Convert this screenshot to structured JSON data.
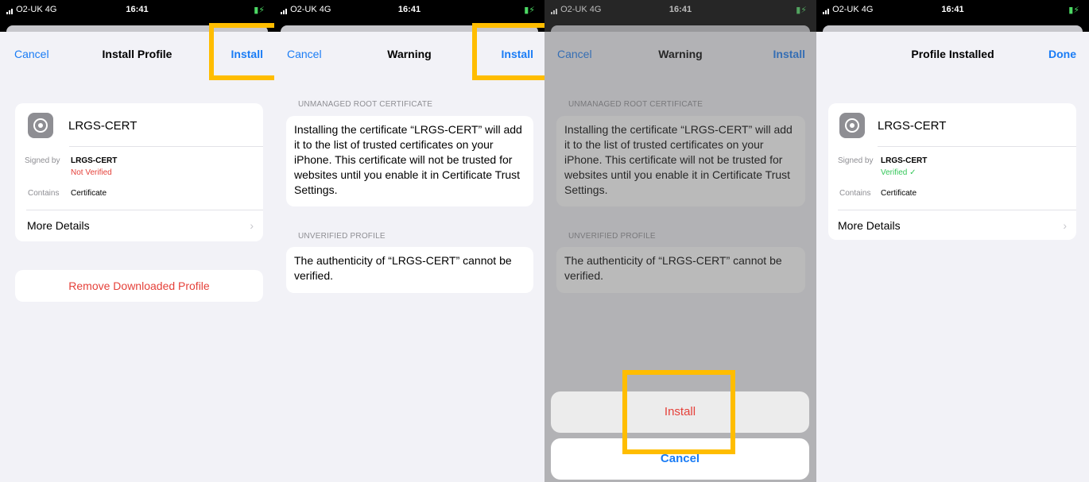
{
  "status": {
    "carrier": "O2-UK",
    "network": "4G",
    "time": "16:41"
  },
  "screen1": {
    "nav": {
      "left": "Cancel",
      "title": "Install Profile",
      "right": "Install"
    },
    "profile": {
      "name": "LRGS-CERT",
      "signed_by_label": "Signed by",
      "signed_by_value": "LRGS-CERT",
      "verification": "Not Verified",
      "contains_label": "Contains",
      "contains_value": "Certificate"
    },
    "more_details": "More Details",
    "remove": "Remove Downloaded Profile"
  },
  "screen2": {
    "nav": {
      "left": "Cancel",
      "title": "Warning",
      "right": "Install"
    },
    "section1": "UNMANAGED ROOT CERTIFICATE",
    "warning_text": "Installing the certificate “LRGS-CERT” will add it to the list of trusted certificates on your iPhone. This certificate will not be trusted for websites until you enable it in Certificate Trust Settings.",
    "section2": "UNVERIFIED PROFILE",
    "unverified_text": "The authenticity of “LRGS-CERT” cannot be verified."
  },
  "screen3": {
    "nav": {
      "left": "Cancel",
      "title": "Warning",
      "right": "Install"
    },
    "section1": "UNMANAGED ROOT CERTIFICATE",
    "warning_text": "Installing the certificate “LRGS-CERT” will add it to the list of trusted certificates on your iPhone. This certificate will not be trusted for websites until you enable it in Certificate Trust Settings.",
    "section2": "UNVERIFIED PROFILE",
    "unverified_text": "The authenticity of “LRGS-CERT” cannot be verified.",
    "action_install": "Install",
    "action_cancel": "Cancel"
  },
  "screen4": {
    "nav": {
      "title": "Profile Installed",
      "right": "Done"
    },
    "profile": {
      "name": "LRGS-CERT",
      "signed_by_label": "Signed by",
      "signed_by_value": "LRGS-CERT",
      "verification": "Verified ✓",
      "contains_label": "Contains",
      "contains_value": "Certificate"
    },
    "more_details": "More Details"
  },
  "colors": {
    "link": "#1a7cf5",
    "danger": "#e5413a",
    "verified": "#34c759",
    "highlight": "#ffbd00"
  },
  "icons": [
    "signal-icon",
    "battery-charging-icon",
    "settings-gear-icon",
    "chevron-right-icon"
  ]
}
